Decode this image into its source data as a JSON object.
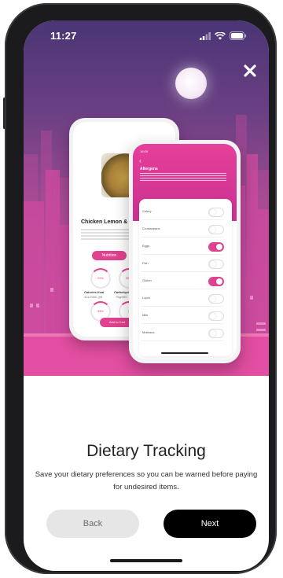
{
  "status_bar": {
    "time": "11:27"
  },
  "illustration": {
    "back_phone": {
      "title": "Chicken Lemon & Or",
      "tab_label": "Nutrition",
      "rings": [
        {
          "value": "25%",
          "label": "Calories Kcal",
          "sub": "311/2000 (69"
        },
        {
          "value": "35%",
          "label": "Carbohydr",
          "sub": "75g/260"
        },
        {
          "value": "35%",
          "label": "",
          "sub": ""
        },
        {
          "value": "3",
          "label": "",
          "sub": ""
        }
      ],
      "cart_label": "Add to Cart"
    },
    "front_phone": {
      "time": "16:09",
      "title": "Allergens",
      "allergens": [
        {
          "label": "Celery",
          "on": false
        },
        {
          "label": "Crustaceans",
          "on": false
        },
        {
          "label": "Eggs",
          "on": true
        },
        {
          "label": "Fish",
          "on": false
        },
        {
          "label": "Gluten",
          "on": true
        },
        {
          "label": "Lupin",
          "on": false
        },
        {
          "label": "Milk",
          "on": false
        },
        {
          "label": "Molluscs",
          "on": false
        }
      ]
    }
  },
  "content": {
    "heading": "Dietary Tracking",
    "description": "Save your dietary preferences so you can be warned before paying for undesired items.",
    "back_label": "Back",
    "next_label": "Next"
  },
  "colors": {
    "accent": "#e0428f",
    "primary_button": "#000000",
    "secondary_button": "#e6e6e6"
  },
  "icons": {
    "close": "close-icon",
    "signal": "signal-icon",
    "wifi": "wifi-icon",
    "battery": "battery-icon"
  }
}
